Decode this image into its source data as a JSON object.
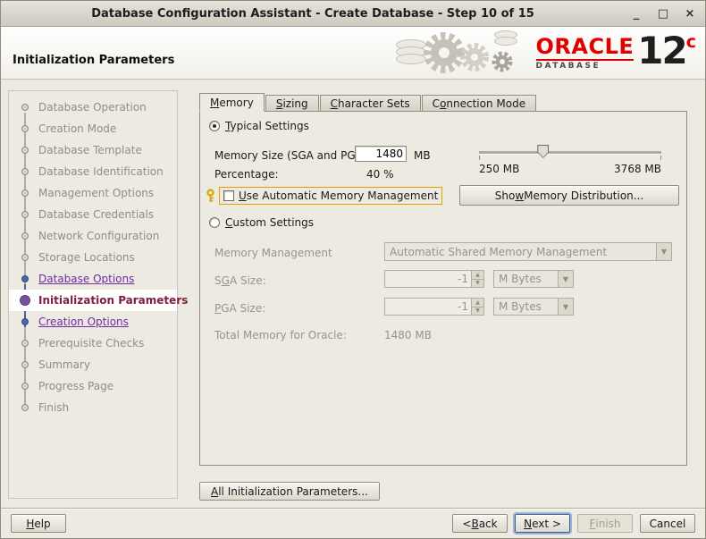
{
  "window": {
    "title": "Database Configuration Assistant - Create Database - Step 10 of 15"
  },
  "icons": {
    "minimize": "_",
    "maximize": "□",
    "close": "×",
    "dropdown_arrow": "▼",
    "spinner_up": "▲",
    "spinner_down": "▼"
  },
  "header": {
    "title": "Initialization Parameters",
    "brand": {
      "name": "ORACLE",
      "version_number": "12",
      "version_suffix": "c",
      "product": "DATABASE"
    }
  },
  "sidebar": {
    "steps": [
      {
        "label": "Database Operation",
        "state": "done"
      },
      {
        "label": "Creation Mode",
        "state": "done"
      },
      {
        "label": "Database Template",
        "state": "done"
      },
      {
        "label": "Database Identification",
        "state": "done"
      },
      {
        "label": "Management Options",
        "state": "done"
      },
      {
        "label": "Database Credentials",
        "state": "done"
      },
      {
        "label": "Network Configuration",
        "state": "done"
      },
      {
        "label": "Storage Locations",
        "state": "done"
      },
      {
        "label": "Database Options",
        "state": "link"
      },
      {
        "label": "Initialization Parameters",
        "state": "current"
      },
      {
        "label": "Creation Options",
        "state": "link"
      },
      {
        "label": "Prerequisite Checks",
        "state": "pending"
      },
      {
        "label": "Summary",
        "state": "pending"
      },
      {
        "label": "Progress Page",
        "state": "pending"
      },
      {
        "label": "Finish",
        "state": "pending"
      }
    ]
  },
  "tabs": [
    {
      "label": "Memory",
      "active": true
    },
    {
      "label": "Sizing",
      "active": false
    },
    {
      "label": "Character Sets",
      "active": false
    },
    {
      "label": "Connection Mode",
      "active": false
    }
  ],
  "memory": {
    "typical": {
      "label": "Typical Settings",
      "selected": true
    },
    "memory_size": {
      "label": "Memory Size (SGA and PGA):",
      "value": "1480",
      "unit": "MB"
    },
    "percentage": {
      "label": "Percentage:",
      "value": "40 %"
    },
    "slider": {
      "min": 250,
      "max": 3768,
      "value": 1480,
      "min_label": "250 MB",
      "max_label": "3768 MB"
    },
    "amm": {
      "label": "Use Automatic Memory Management",
      "checked": false
    },
    "show_distribution": "Show Memory Distribution...",
    "custom": {
      "label": "Custom Settings",
      "selected": false
    },
    "memory_management": {
      "label": "Memory Management",
      "value": "Automatic Shared Memory Management",
      "disabled": true
    },
    "sga": {
      "label": "SGA Size:",
      "value": "-1",
      "unit": "M Bytes",
      "disabled": true
    },
    "pga": {
      "label": "PGA Size:",
      "value": "-1",
      "unit": "M Bytes",
      "disabled": true
    },
    "total": {
      "label": "Total Memory for Oracle:",
      "value": "1480 MB"
    }
  },
  "actions": {
    "all_init_params": "All Initialization Parameters...",
    "help": "Help",
    "back": "< Back",
    "next": "Next >",
    "finish": "Finish",
    "cancel": "Cancel"
  }
}
